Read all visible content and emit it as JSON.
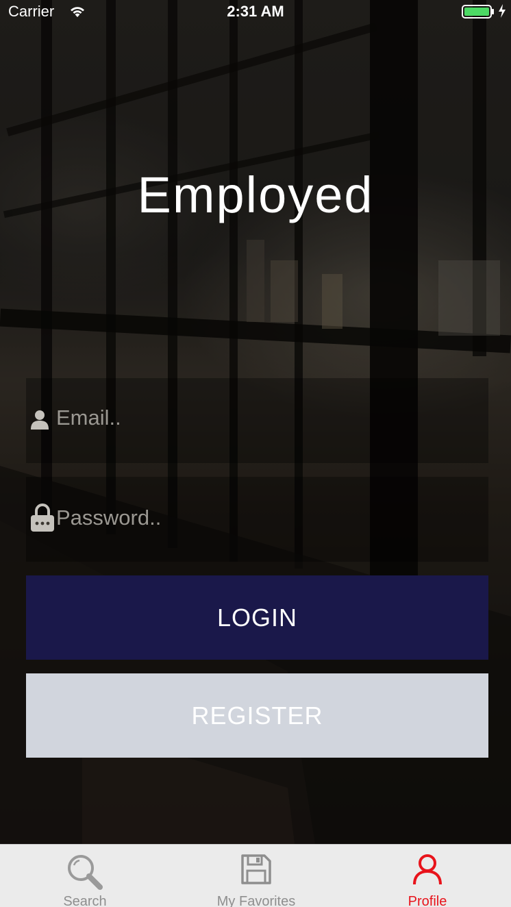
{
  "status_bar": {
    "carrier": "Carrier",
    "time": "2:31 AM",
    "wifi_icon": "wifi-icon",
    "battery_icon": "battery-icon",
    "battery_color": "#4cd964"
  },
  "app": {
    "title": "Employed"
  },
  "form": {
    "email": {
      "icon": "person-icon",
      "placeholder": "Email..",
      "value": ""
    },
    "password": {
      "icon": "lock-icon",
      "placeholder": "Password..",
      "value": ""
    }
  },
  "buttons": {
    "login_label": "LOGIN",
    "login_color": "#1a184a",
    "register_label": "REGISTER",
    "register_color": "#d1d5dd"
  },
  "tab_bar": {
    "active_color": "#e8131b",
    "inactive_color": "#8e8e8e",
    "tabs": [
      {
        "label": "Search",
        "icon": "search-icon",
        "active": false
      },
      {
        "label": "My Favorites",
        "icon": "floppy-disk-icon",
        "active": false
      },
      {
        "label": "Profile",
        "icon": "profile-icon",
        "active": true
      }
    ]
  }
}
